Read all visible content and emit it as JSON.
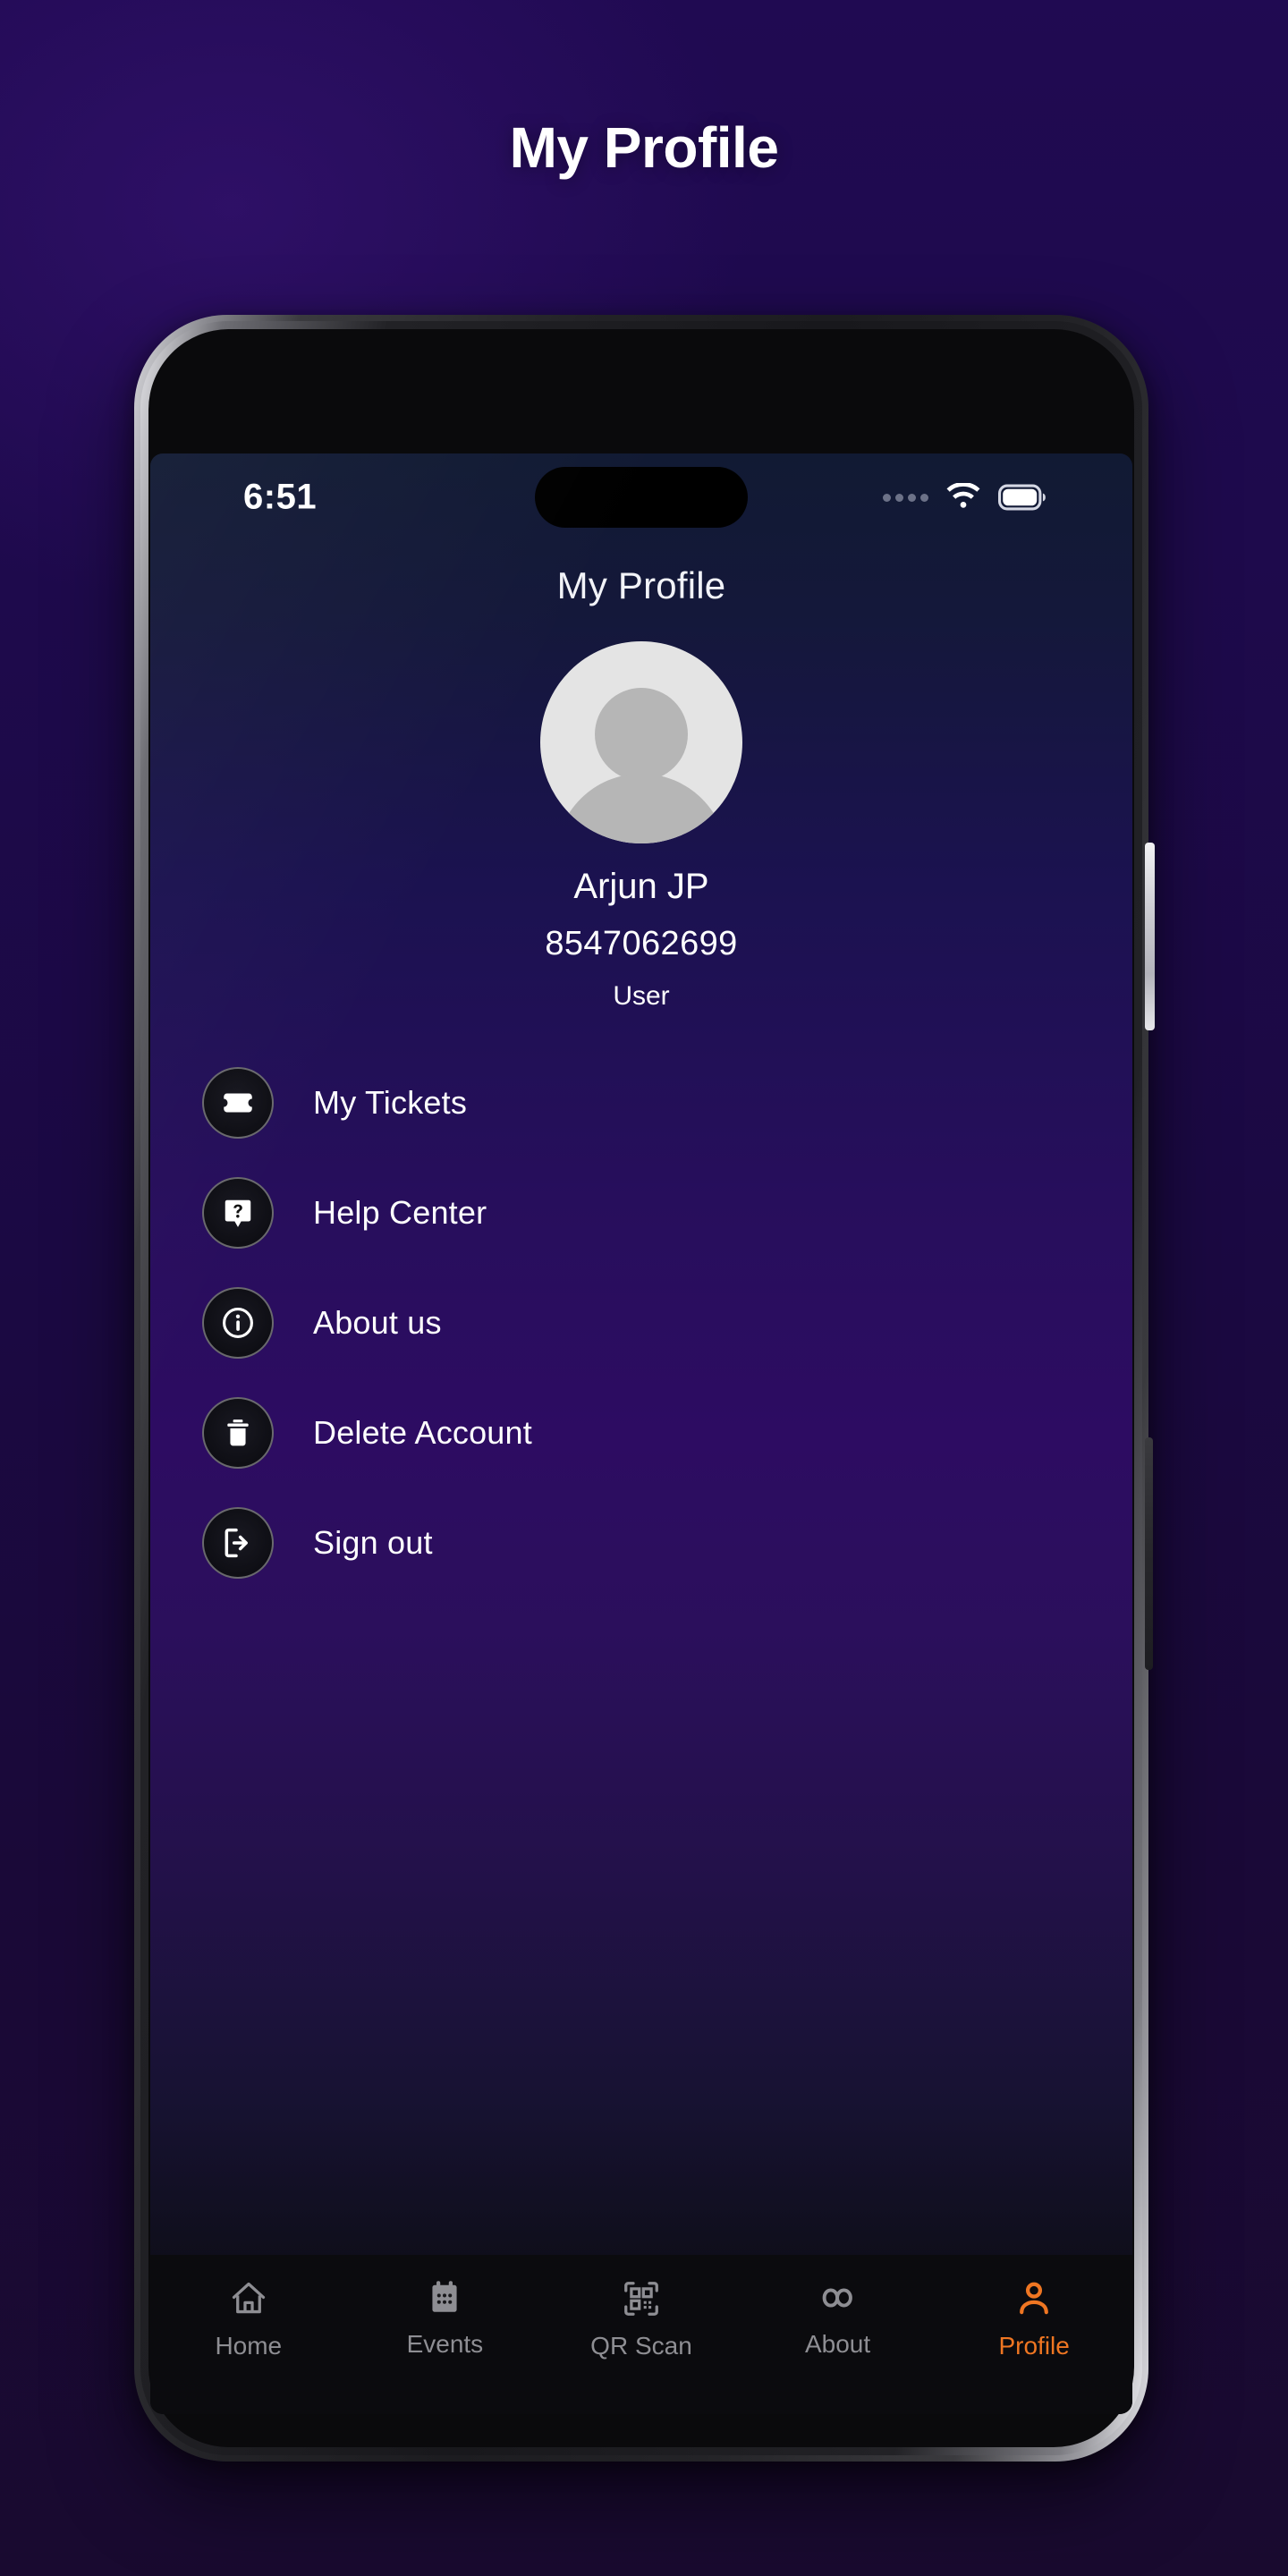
{
  "header": {
    "title": "My Profile"
  },
  "device": {
    "icons": {
      "camera": "camera-lens",
      "sensor": "proximity-sensor",
      "earpiece": "earpiece-speaker",
      "power": "power-button",
      "volume": "volume-buttons"
    }
  },
  "status_bar": {
    "time": "6:51",
    "signal_icon": "signal-dots-icon",
    "wifi_icon": "wifi-icon",
    "battery_icon": "battery-full-icon",
    "dynamic_island": "dynamic-island"
  },
  "app": {
    "title": "My Profile",
    "avatar_icon": "default-avatar-icon",
    "profile": {
      "name": "Arjun JP",
      "phone": "8547062699",
      "role": "User"
    },
    "menu": [
      {
        "label": "My Tickets",
        "icon": "ticket-icon"
      },
      {
        "label": "Help Center",
        "icon": "question-chat-icon"
      },
      {
        "label": "About us",
        "icon": "info-circle-icon"
      },
      {
        "label": "Delete Account",
        "icon": "trash-icon"
      },
      {
        "label": "Sign out",
        "icon": "logout-icon"
      }
    ],
    "tabs": [
      {
        "label": "Home",
        "icon": "home-icon",
        "active": false
      },
      {
        "label": "Events",
        "icon": "calendar-icon",
        "active": false
      },
      {
        "label": "QR Scan",
        "icon": "qr-code-icon",
        "active": false
      },
      {
        "label": "About",
        "icon": "infinity-icon",
        "active": false
      },
      {
        "label": "Profile",
        "icon": "person-icon",
        "active": true
      }
    ]
  },
  "colors": {
    "page_bg_top": "#200a52",
    "page_bg_bottom": "#190a2f",
    "screen_top": "#111a33",
    "screen_mid": "#2d0c62",
    "screen_bottom": "#0a0a0e",
    "accent": "#ef7622",
    "tab_inactive": "#8e8e93",
    "text_primary": "#ffffff",
    "avatar_bg": "#e4e4e4",
    "avatar_fg": "#b6b6b6",
    "tabbar_bg": "#0b0b0e"
  }
}
